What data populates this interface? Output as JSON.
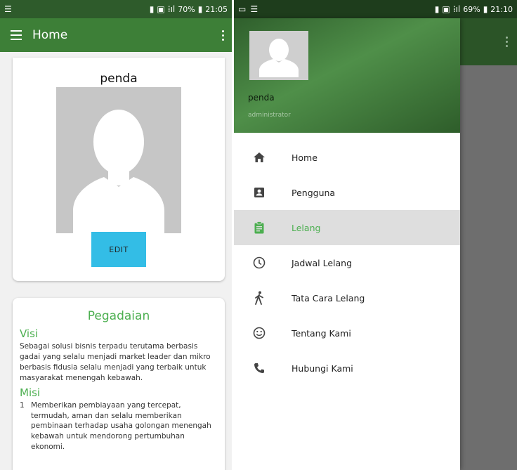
{
  "left": {
    "status": {
      "battery": "70%",
      "time": "21:05"
    },
    "appbar": {
      "title": "Home"
    },
    "profile": {
      "name": "penda",
      "edit_label": "EDIT"
    },
    "info": {
      "title": "Pegadaian",
      "visi_heading": "Visi",
      "visi_text": "Sebagai solusi bisnis terpadu terutama berbasis gadai yang selalu menjadi market leader dan mikro berbasis fidusia selalu menjadi yang terbaik untuk masyarakat menengah kebawah.",
      "misi_heading": "Misi",
      "misi_items": [
        {
          "num": "1",
          "text": "Memberikan pembiayaan yang tercepat, termudah, aman dan selalu memberikan pembinaan terhadap usaha golongan menengah kebawah untuk mendorong pertumbuhan ekonomi."
        }
      ]
    }
  },
  "right": {
    "status": {
      "battery": "69%",
      "time": "21:10"
    },
    "drawer": {
      "name": "penda",
      "role": "administrator"
    },
    "menu": [
      {
        "label": "Home",
        "icon": "home-icon"
      },
      {
        "label": "Pengguna",
        "icon": "account-box-icon"
      },
      {
        "label": "Lelang",
        "icon": "clipboard-icon",
        "active": true
      },
      {
        "label": "Jadwal Lelang",
        "icon": "clock-icon"
      },
      {
        "label": "Tata Cara Lelang",
        "icon": "walking-person-icon"
      },
      {
        "label": "Tentang Kami",
        "icon": "smiley-icon"
      },
      {
        "label": "Hubungi Kami",
        "icon": "phone-icon"
      }
    ]
  },
  "colors": {
    "primary": "#3d7f37",
    "primary_dark": "#2e5b2b",
    "accent_green": "#4caf50",
    "edit_button": "#33bde6",
    "scrim": "#6e6e6e",
    "active_item_bg": "#dedede"
  }
}
